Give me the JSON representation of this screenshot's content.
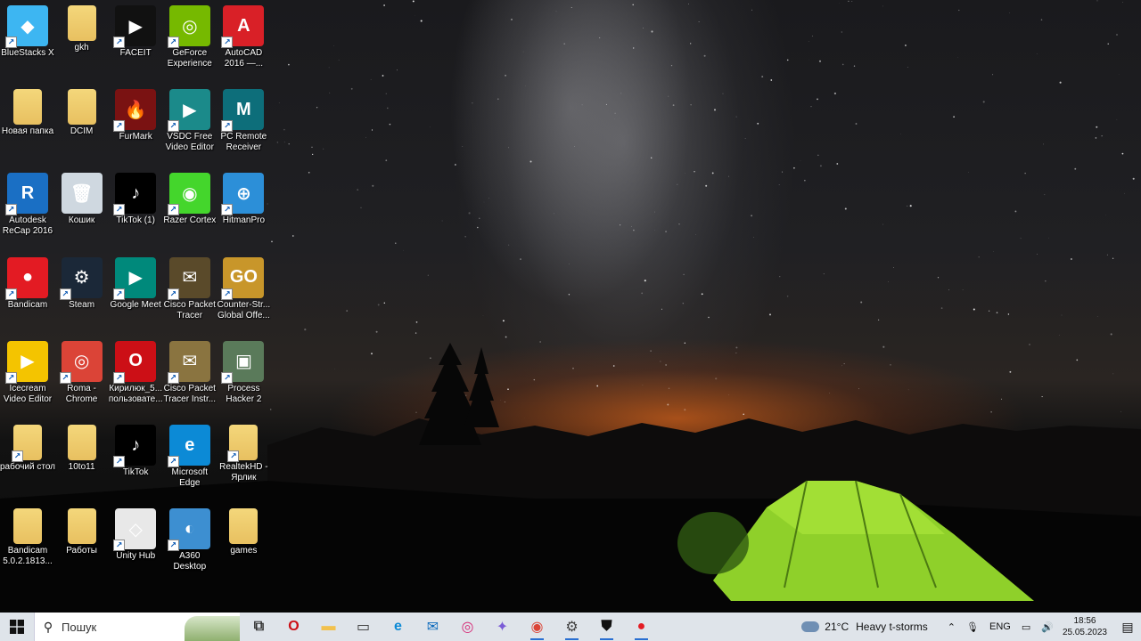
{
  "desktop_icons": [
    {
      "label": "BlueStacks X",
      "color": "#3db6f2",
      "glyph": "◆",
      "col": 0,
      "row": 0,
      "shortcut": true
    },
    {
      "label": "gkh",
      "color": "folder",
      "glyph": "",
      "col": 1,
      "row": 0,
      "shortcut": false
    },
    {
      "label": "FACEIT",
      "color": "#111111",
      "glyph": "▶",
      "col": 2,
      "row": 0,
      "shortcut": true
    },
    {
      "label": "GeForce Experience",
      "color": "#76b900",
      "glyph": "◎",
      "col": 3,
      "row": 0,
      "shortcut": true
    },
    {
      "label": "AutoCAD 2016 —...",
      "color": "#d92027",
      "glyph": "A",
      "col": 4,
      "row": 0,
      "shortcut": true
    },
    {
      "label": "Новая папка",
      "color": "folder",
      "glyph": "",
      "col": 0,
      "row": 1,
      "shortcut": false
    },
    {
      "label": "DCIM",
      "color": "folder",
      "glyph": "",
      "col": 1,
      "row": 1,
      "shortcut": false
    },
    {
      "label": "FurMark",
      "color": "#7a1212",
      "glyph": "🔥",
      "col": 2,
      "row": 1,
      "shortcut": true
    },
    {
      "label": "VSDC Free Video Editor",
      "color": "#1b8a8a",
      "glyph": "▶",
      "col": 3,
      "row": 1,
      "shortcut": true
    },
    {
      "label": "PC Remote Receiver",
      "color": "#0d6e7a",
      "glyph": "M",
      "col": 4,
      "row": 1,
      "shortcut": true
    },
    {
      "label": "Autodesk ReCap 2016",
      "color": "#1a6fc4",
      "glyph": "R",
      "col": 0,
      "row": 2,
      "shortcut": true
    },
    {
      "label": "Кошик",
      "color": "#cfd8e0",
      "glyph": "🗑",
      "col": 1,
      "row": 2,
      "shortcut": false
    },
    {
      "label": "TikTok (1)",
      "color": "#000000",
      "glyph": "♪",
      "col": 2,
      "row": 2,
      "shortcut": true
    },
    {
      "label": "Razer Cortex",
      "color": "#44d62c",
      "glyph": "◉",
      "col": 3,
      "row": 2,
      "shortcut": true
    },
    {
      "label": "HitmanPro",
      "color": "#2c8fd8",
      "glyph": "⊕",
      "col": 4,
      "row": 2,
      "shortcut": true
    },
    {
      "label": "Bandicam",
      "color": "#e31b23",
      "glyph": "●",
      "col": 0,
      "row": 3,
      "shortcut": true
    },
    {
      "label": "Steam",
      "color": "#1b2838",
      "glyph": "⚙",
      "col": 1,
      "row": 3,
      "shortcut": true
    },
    {
      "label": "Google Meet",
      "color": "#00897b",
      "glyph": "▶",
      "col": 2,
      "row": 3,
      "shortcut": true
    },
    {
      "label": "Cisco Packet Tracer",
      "color": "#5a4a2a",
      "glyph": "✉",
      "col": 3,
      "row": 3,
      "shortcut": true
    },
    {
      "label": "Counter-Str... Global Offe...",
      "color": "#c8962a",
      "glyph": "GO",
      "col": 4,
      "row": 3,
      "shortcut": true
    },
    {
      "label": "Icecream Video Editor",
      "color": "#f4c400",
      "glyph": "▶",
      "col": 0,
      "row": 4,
      "shortcut": true
    },
    {
      "label": "Roma - Chrome",
      "color": "#db4437",
      "glyph": "◎",
      "col": 1,
      "row": 4,
      "shortcut": true
    },
    {
      "label": "Кирилюк_5... пользовате...",
      "color": "#cc0f16",
      "glyph": "O",
      "col": 2,
      "row": 4,
      "shortcut": true
    },
    {
      "label": "Cisco Packet Tracer Instr...",
      "color": "#8a7440",
      "glyph": "✉",
      "col": 3,
      "row": 4,
      "shortcut": true
    },
    {
      "label": "Process Hacker 2",
      "color": "#5a7a5a",
      "glyph": "▣",
      "col": 4,
      "row": 4,
      "shortcut": true
    },
    {
      "label": "рабочий стол",
      "color": "folder",
      "glyph": "",
      "col": 0,
      "row": 5,
      "shortcut": true
    },
    {
      "label": "10to11",
      "color": "folder",
      "glyph": "",
      "col": 1,
      "row": 5,
      "shortcut": false
    },
    {
      "label": "TikTok",
      "color": "#000000",
      "glyph": "♪",
      "col": 2,
      "row": 5,
      "shortcut": true
    },
    {
      "label": "Microsoft Edge",
      "color": "#0c8ad6",
      "glyph": "e",
      "col": 3,
      "row": 5,
      "shortcut": true
    },
    {
      "label": "RealtekHD - Ярлик",
      "color": "folder",
      "glyph": "",
      "col": 4,
      "row": 5,
      "shortcut": true
    },
    {
      "label": "Bandicam 5.0.2.1813...",
      "color": "folder",
      "glyph": "",
      "col": 0,
      "row": 6,
      "shortcut": false
    },
    {
      "label": "Работы",
      "color": "folder",
      "glyph": "",
      "col": 1,
      "row": 6,
      "shortcut": false
    },
    {
      "label": "Unity Hub",
      "color": "#e8e8e8",
      "glyph": "◇",
      "col": 2,
      "row": 6,
      "shortcut": true
    },
    {
      "label": "A360 Desktop",
      "color": "#3d8fd1",
      "glyph": "◐",
      "col": 3,
      "row": 6,
      "shortcut": true
    },
    {
      "label": "games",
      "color": "folder",
      "glyph": "",
      "col": 4,
      "row": 6,
      "shortcut": false
    }
  ],
  "taskbar": {
    "search_placeholder": "Пошук",
    "apps": [
      {
        "name": "task-view-icon",
        "color": "#333333",
        "glyph": "⧉",
        "active": false
      },
      {
        "name": "opera-icon",
        "color": "#cc0f16",
        "glyph": "O",
        "active": false
      },
      {
        "name": "file-explorer-icon",
        "color": "#f2c14e",
        "glyph": "▬",
        "active": false
      },
      {
        "name": "camera-icon",
        "color": "#333333",
        "glyph": "▭",
        "active": false
      },
      {
        "name": "edge-icon",
        "color": "#0c8ad6",
        "glyph": "e",
        "active": false
      },
      {
        "name": "mail-icon",
        "color": "#0f6cbd",
        "glyph": "✉",
        "active": false
      },
      {
        "name": "instagram-icon",
        "color": "#d62976",
        "glyph": "◎",
        "active": false
      },
      {
        "name": "copilot-icon",
        "color": "#7b5cd6",
        "glyph": "✦",
        "active": false
      },
      {
        "name": "chrome-icon",
        "color": "#db4437",
        "glyph": "◉",
        "active": true
      },
      {
        "name": "settings-icon",
        "color": "#444444",
        "glyph": "⚙",
        "active": true
      },
      {
        "name": "shield-icon",
        "color": "#111111",
        "glyph": "⛊",
        "active": true
      },
      {
        "name": "bandicam-icon",
        "color": "#e31b23",
        "glyph": "●",
        "active": true
      }
    ],
    "weather": {
      "temp": "21°C",
      "desc": "Heavy t-storms"
    },
    "language": "ENG",
    "time": "18:56",
    "date": "25.05.2023"
  }
}
